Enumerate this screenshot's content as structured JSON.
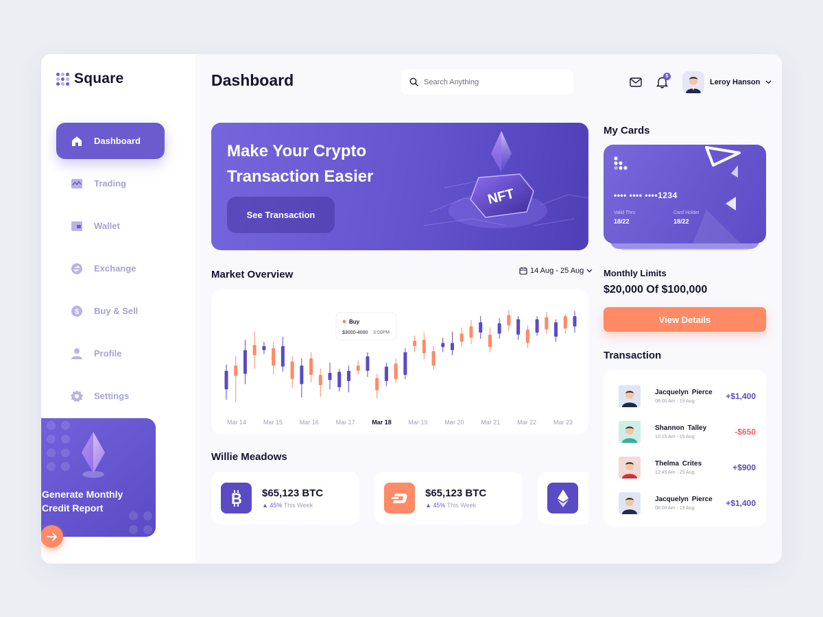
{
  "brand": {
    "name": "Square"
  },
  "sidebar": {
    "items": [
      {
        "label": "Dashboard",
        "icon": "home-icon"
      },
      {
        "label": "Trading",
        "icon": "trading-chart-icon"
      },
      {
        "label": "Wallet",
        "icon": "wallet-icon"
      },
      {
        "label": "Exchange",
        "icon": "exchange-icon"
      },
      {
        "label": "Buy & Sell",
        "icon": "dollar-icon"
      },
      {
        "label": "Profile",
        "icon": "user-icon"
      },
      {
        "label": "Settings",
        "icon": "gear-icon"
      }
    ],
    "promo": {
      "title": "Generate Monthly Credit Report",
      "icon": "ethereum-gem-icon"
    }
  },
  "header": {
    "title": "Dashboard",
    "search_placeholder": "Search Anything",
    "notification_count": "5",
    "user_name": "Leroy Hanson"
  },
  "hero": {
    "title": "Make Your Crypto Transaction Easier",
    "button": "See Transaction",
    "art_text": "NFT"
  },
  "market": {
    "title": "Market Overview",
    "date_range": "14 Aug - 25 Aug",
    "tooltip_label": "Buy",
    "tooltip_range": "$3000-4000",
    "tooltip_time": "3:00PM"
  },
  "chart_data": {
    "type": "candlestick",
    "categories": [
      "Mar 14",
      "Mar 15",
      "Mar 16",
      "Mar 17",
      "Mar 18",
      "Mar 19",
      "Mar 20",
      "Mar 21",
      "Mar 22",
      "Mar 23"
    ],
    "highlighted_category": "Mar 18",
    "colors": {
      "up": "#ff8a65",
      "down": "#5a4bc4"
    },
    "candles": [
      {
        "open": 30,
        "close": 48,
        "high": 54,
        "low": 20,
        "dir": "down"
      },
      {
        "open": 43,
        "close": 53,
        "high": 62,
        "low": 18,
        "dir": "up"
      },
      {
        "open": 45,
        "close": 68,
        "high": 78,
        "low": 35,
        "dir": "down"
      },
      {
        "open": 63,
        "close": 73,
        "high": 86,
        "low": 50,
        "dir": "up"
      },
      {
        "open": 68,
        "close": 72,
        "high": 76,
        "low": 64,
        "dir": "down"
      },
      {
        "open": 53,
        "close": 70,
        "high": 76,
        "low": 44,
        "dir": "up"
      },
      {
        "open": 52,
        "close": 72,
        "high": 81,
        "low": 47,
        "dir": "down"
      },
      {
        "open": 40,
        "close": 57,
        "high": 62,
        "low": 31,
        "dir": "up"
      },
      {
        "open": 35,
        "close": 53,
        "high": 60,
        "low": 22,
        "dir": "down"
      },
      {
        "open": 44,
        "close": 60,
        "high": 66,
        "low": 37,
        "dir": "up"
      },
      {
        "open": 34,
        "close": 44,
        "high": 50,
        "low": 23,
        "dir": "up"
      },
      {
        "open": 39,
        "close": 46,
        "high": 56,
        "low": 30,
        "dir": "down"
      },
      {
        "open": 32,
        "close": 47,
        "high": 50,
        "low": 28,
        "dir": "down"
      },
      {
        "open": 38,
        "close": 48,
        "high": 53,
        "low": 27,
        "dir": "down"
      },
      {
        "open": 48,
        "close": 53,
        "high": 58,
        "low": 44,
        "dir": "up"
      },
      {
        "open": 48,
        "close": 62,
        "high": 66,
        "low": 42,
        "dir": "down"
      },
      {
        "open": 29,
        "close": 41,
        "high": 45,
        "low": 21,
        "dir": "up"
      },
      {
        "open": 38,
        "close": 52,
        "high": 56,
        "low": 33,
        "dir": "down"
      },
      {
        "open": 40,
        "close": 55,
        "high": 60,
        "low": 36,
        "dir": "up"
      },
      {
        "open": 44,
        "close": 66,
        "high": 70,
        "low": 40,
        "dir": "down"
      },
      {
        "open": 72,
        "close": 77,
        "high": 82,
        "low": 66,
        "dir": "up"
      },
      {
        "open": 65,
        "close": 78,
        "high": 85,
        "low": 59,
        "dir": "up"
      },
      {
        "open": 53,
        "close": 67,
        "high": 72,
        "low": 49,
        "dir": "up"
      },
      {
        "open": 71,
        "close": 75,
        "high": 80,
        "low": 66,
        "dir": "down"
      },
      {
        "open": 68,
        "close": 75,
        "high": 86,
        "low": 63,
        "dir": "down"
      },
      {
        "open": 76,
        "close": 84,
        "high": 90,
        "low": 71,
        "dir": "up"
      },
      {
        "open": 80,
        "close": 91,
        "high": 97,
        "low": 74,
        "dir": "up"
      },
      {
        "open": 85,
        "close": 95,
        "high": 101,
        "low": 79,
        "dir": "down"
      },
      {
        "open": 71,
        "close": 83,
        "high": 90,
        "low": 66,
        "dir": "up"
      },
      {
        "open": 84,
        "close": 94,
        "high": 99,
        "low": 79,
        "dir": "down"
      },
      {
        "open": 92,
        "close": 102,
        "high": 107,
        "low": 86,
        "dir": "up"
      },
      {
        "open": 83,
        "close": 98,
        "high": 101,
        "low": 78,
        "dir": "down"
      },
      {
        "open": 75,
        "close": 88,
        "high": 92,
        "low": 70,
        "dir": "up"
      },
      {
        "open": 85,
        "close": 98,
        "high": 101,
        "low": 82,
        "dir": "down"
      },
      {
        "open": 88,
        "close": 100,
        "high": 105,
        "low": 84,
        "dir": "up"
      },
      {
        "open": 81,
        "close": 95,
        "high": 98,
        "low": 76,
        "dir": "down"
      },
      {
        "open": 89,
        "close": 101,
        "high": 103,
        "low": 84,
        "dir": "up"
      },
      {
        "open": 91,
        "close": 101,
        "high": 106,
        "low": 85,
        "dir": "down"
      }
    ],
    "ylim": [
      10,
      115
    ],
    "grid": false,
    "legend": false
  },
  "portfolio": {
    "title": "Willie Meadows",
    "coins": [
      {
        "symbol": "B",
        "icon": "bitcoin-icon",
        "value": "$65,123 BTC",
        "change": "45%",
        "period": "This Week",
        "color": "#5a4bc4"
      },
      {
        "symbol": "D",
        "icon": "dash-icon",
        "value": "$65,123 BTC",
        "change": "45%",
        "period": "This Week",
        "color": "#ff8a65"
      },
      {
        "symbol": "E",
        "icon": "ethereum-icon",
        "value": "",
        "change": "",
        "period": "",
        "color": "#5a4bc4"
      }
    ]
  },
  "cards": {
    "title": "My Cards",
    "number": "•••• •••• ••••1234",
    "valid_label": "Valid Thru",
    "valid_value": "18/22",
    "holder_label": "Card Holder",
    "holder_value": "18/22"
  },
  "limits": {
    "title": "Monthly Limits",
    "value": "$20,000 Of $100,000",
    "button": "View Details"
  },
  "transactions": {
    "title": "Transaction",
    "items": [
      {
        "name": "Jacquelyn  Pierce",
        "time": "08:00 Am - 19 Aug",
        "amount": "+$1,400",
        "positive": true,
        "avatar_bg": "#dfe6f2",
        "shirt": "#1d2a4a"
      },
      {
        "name": "Shannon Talley",
        "time": "10:15 Am - 19 Aug",
        "amount": "-$650",
        "positive": false,
        "avatar_bg": "#cfeee6",
        "shirt": "#35b0a0"
      },
      {
        "name": "Thelma Crites",
        "time": "12:45 Am - 25 Aug",
        "amount": "+$900",
        "positive": true,
        "avatar_bg": "#f4d9d9",
        "shirt": "#c8383a"
      },
      {
        "name": "Jacquelyn  Pierce",
        "time": "08:00 Am - 19 Aug",
        "amount": "+$1,400",
        "positive": true,
        "avatar_bg": "#dfe6f2",
        "shirt": "#1d2a4a"
      }
    ]
  }
}
